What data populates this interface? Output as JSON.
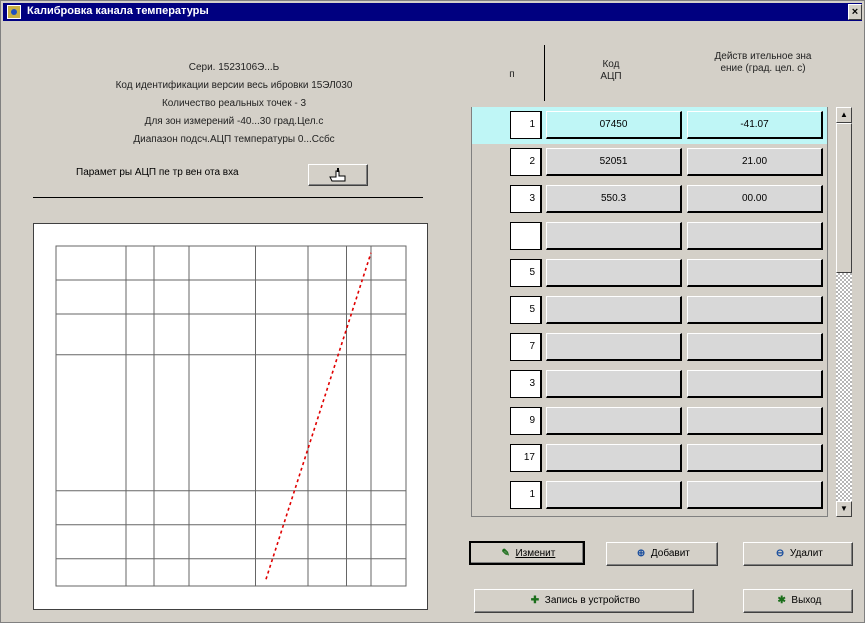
{
  "window": {
    "title": "Калибровка канала температуры",
    "close_glyph": "×"
  },
  "info": {
    "serial": "Сери. 1523106Э...Ь",
    "ident_code": "Код идентификации версии весь ибровки 15ЭЛ030",
    "points_count": "Количество реальных точек - 3",
    "measure_range": "Для зон измерений -40...30 град.Цел.с",
    "adc_range": "Диапазон подсч.АЦП температуры 0...Ссбс",
    "adc_params_label": "Парамет ры АЦП пе тр вен ота вха"
  },
  "table": {
    "headers": {
      "n": "п",
      "code": "Код АЦП",
      "value": "Действ ительное зна ение (град. цел. с)"
    },
    "rows": [
      {
        "n": "1",
        "code": "07450",
        "value": "-41.07"
      },
      {
        "n": "2",
        "code": "52051",
        "value": "21.00"
      },
      {
        "n": "3",
        "code": "550.3",
        "value": "00.00"
      },
      {
        "n": "",
        "code": "",
        "value": ""
      },
      {
        "n": "5",
        "code": "",
        "value": ""
      },
      {
        "n": "5",
        "code": "",
        "value": ""
      },
      {
        "n": "7",
        "code": "",
        "value": ""
      },
      {
        "n": "3",
        "code": "",
        "value": ""
      },
      {
        "n": "9",
        "code": "",
        "value": ""
      },
      {
        "n": "17",
        "code": "",
        "value": ""
      },
      {
        "n": "1",
        "code": "",
        "value": ""
      }
    ],
    "active_row": 0
  },
  "scrollbar": {
    "up_glyph": "▲",
    "down_glyph": "▼"
  },
  "buttons": {
    "calc": "Изменит",
    "add": "Добавит",
    "delete": "Удалит",
    "write": "Запись в устройство",
    "exit": "Выход"
  },
  "chart_data": {
    "type": "line",
    "series": [
      {
        "x": [
          0.6,
          0.9
        ],
        "y": [
          0.02,
          0.98
        ]
      }
    ],
    "grid": true
  }
}
